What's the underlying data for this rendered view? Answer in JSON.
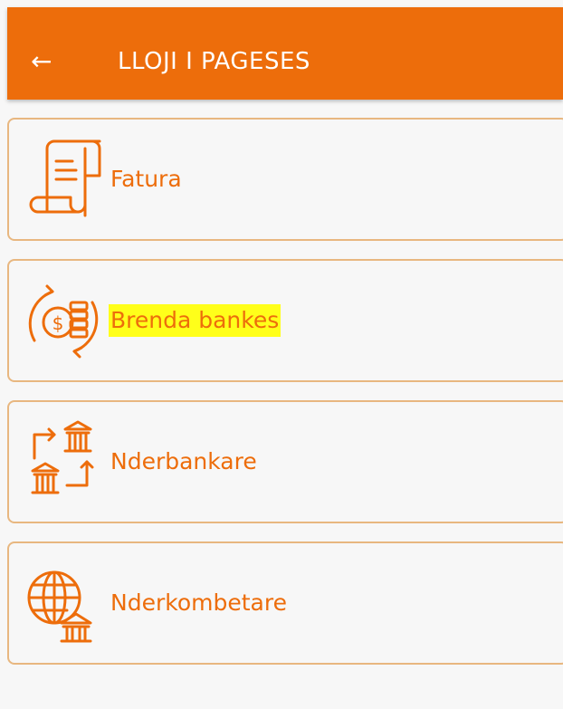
{
  "header": {
    "title": "LLOJI I PAGESES",
    "back_icon": "←"
  },
  "items": [
    {
      "label": "Fatura",
      "icon": "bill-receipt-icon",
      "highlighted": false
    },
    {
      "label": "Brenda bankes",
      "icon": "coins-exchange-icon",
      "highlighted": true
    },
    {
      "label": "Nderbankare",
      "icon": "interbank-transfer-icon",
      "highlighted": false
    },
    {
      "label": "Nderkombetare",
      "icon": "globe-bank-icon",
      "highlighted": false
    }
  ],
  "colors": {
    "accent": "#ed6d0b",
    "card_border": "#e8b780",
    "highlight": "#ffff1a",
    "background": "#f7f7f7"
  }
}
